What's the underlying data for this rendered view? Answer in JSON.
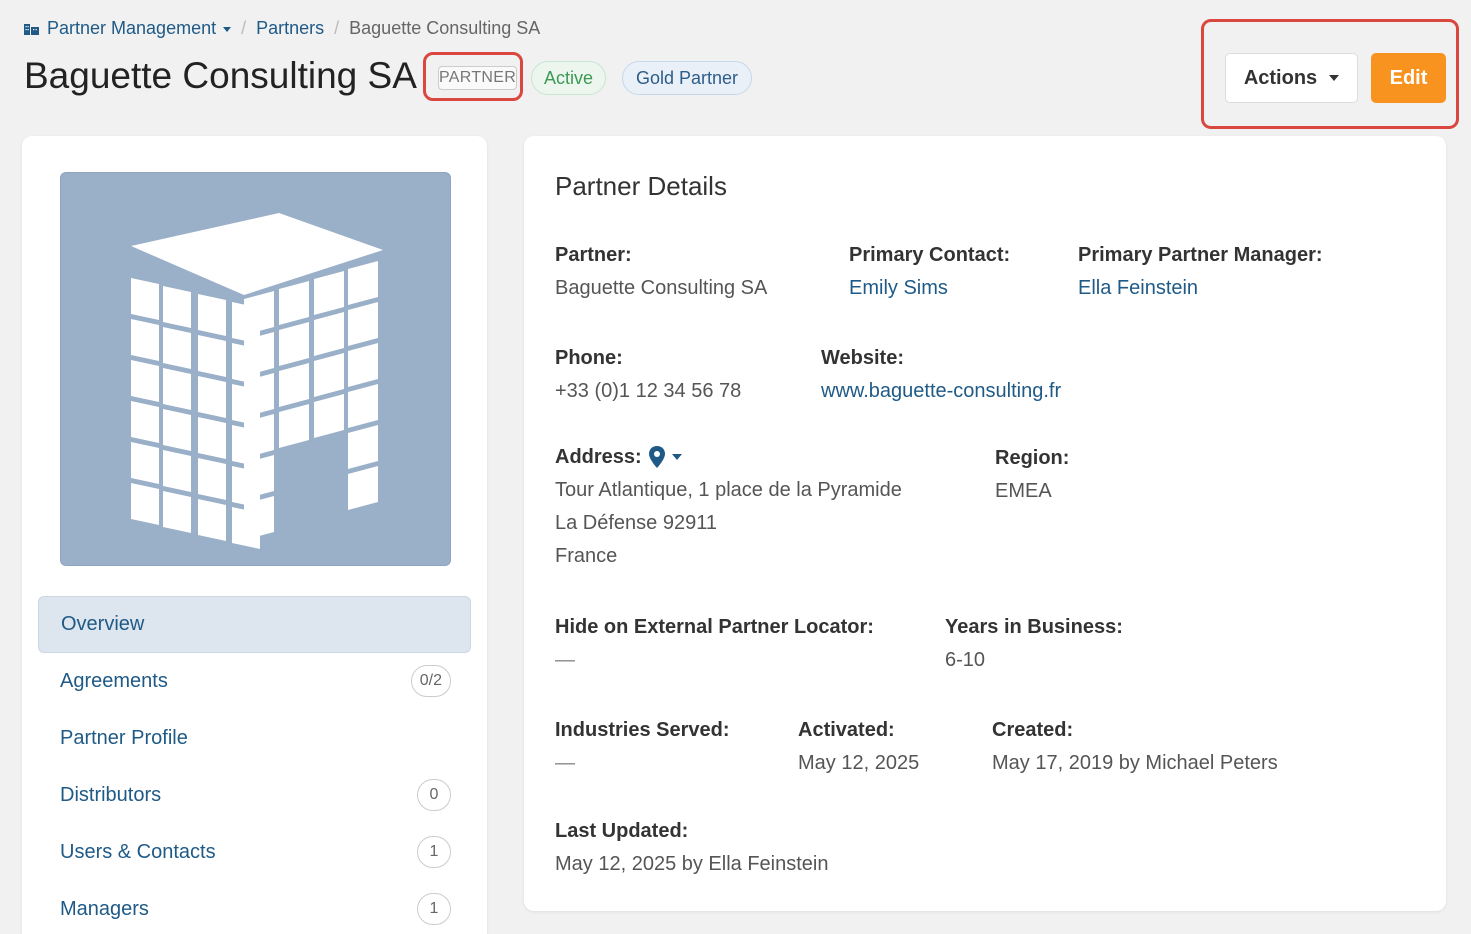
{
  "breadcrumb": {
    "root": "Partner Management",
    "level2": "Partners",
    "current": "Baguette Consulting SA"
  },
  "header": {
    "title": "Baguette Consulting SA",
    "type_badge": "PARTNER",
    "status_badge": "Active",
    "tier_badge": "Gold Partner",
    "actions_label": "Actions",
    "edit_label": "Edit"
  },
  "sidebar": {
    "items": [
      {
        "label": "Overview",
        "count": ""
      },
      {
        "label": "Agreements",
        "count": "0/2"
      },
      {
        "label": "Partner Profile",
        "count": ""
      },
      {
        "label": "Distributors",
        "count": "0"
      },
      {
        "label": "Users & Contacts",
        "count": "1"
      },
      {
        "label": "Managers",
        "count": "1"
      }
    ]
  },
  "details": {
    "title": "Partner Details",
    "partner": {
      "label": "Partner:",
      "value": "Baguette Consulting SA"
    },
    "primary_contact": {
      "label": "Primary Contact:",
      "value": "Emily Sims"
    },
    "primary_manager": {
      "label": "Primary Partner Manager:",
      "value": "Ella Feinstein"
    },
    "phone": {
      "label": "Phone:",
      "value": "+33 (0)1 12 34 56 78"
    },
    "website": {
      "label": "Website:",
      "value": "www.baguette-consulting.fr"
    },
    "address": {
      "label": "Address:",
      "line1": "Tour Atlantique, 1 place de la Pyramide",
      "line2": "La Défense 92911",
      "line3": "France"
    },
    "region": {
      "label": "Region:",
      "value": "EMEA"
    },
    "hide_locator": {
      "label": "Hide on External Partner Locator:",
      "value": "—"
    },
    "years": {
      "label": "Years in Business:",
      "value": "6-10"
    },
    "industries": {
      "label": "Industries Served:",
      "value": "—"
    },
    "activated": {
      "label": "Activated:",
      "value": "May 12, 2025"
    },
    "created": {
      "label": "Created:",
      "value": "May 17, 2019 by Michael Peters"
    },
    "updated": {
      "label": "Last Updated:",
      "value": "May 12, 2025 by Ella Feinstein"
    }
  },
  "colors": {
    "accent": "#f7931e",
    "link": "#1f5a87",
    "highlight": "#d9473f"
  }
}
